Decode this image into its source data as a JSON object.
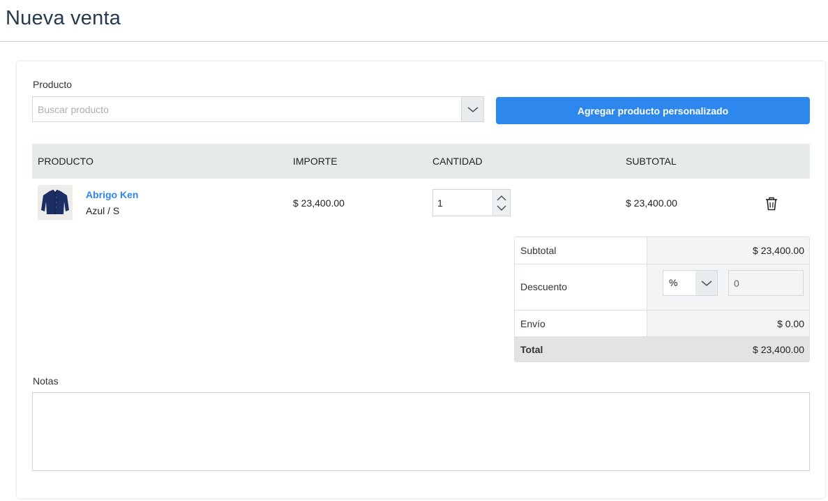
{
  "page": {
    "title": "Nueva venta"
  },
  "product_search": {
    "label": "Producto",
    "placeholder": "Buscar producto",
    "caret_icon": "chevron-down-icon"
  },
  "add_custom_button": {
    "label": "Agregar producto personalizado"
  },
  "table": {
    "headers": [
      "PRODUCTO",
      "IMPORTE",
      "CANTIDAD",
      "SUBTOTAL"
    ],
    "rows": [
      {
        "name": "Abrigo Ken",
        "variant": "Azul / S",
        "price": "$ 23,400.00",
        "quantity": "1",
        "subtotal": "$ 23,400.00",
        "thumbnail_icon": "jacket-image",
        "delete_icon": "trash-icon"
      }
    ]
  },
  "totals": {
    "subtotal_label": "Subtotal",
    "subtotal_value": "$ 23,400.00",
    "discount_label": "Descuento",
    "discount_type": "%",
    "discount_value": "0",
    "shipping_label": "Envío",
    "shipping_value": "$ 0.00",
    "total_label": "Total",
    "total_value": "$ 23,400.00"
  },
  "notes": {
    "label": "Notas",
    "value": ""
  },
  "colors": {
    "primary": "#2d87ec",
    "title": "#253a4e",
    "table_header_bg": "#e7eaeb",
    "total_row_bg": "#e3e3e3"
  }
}
